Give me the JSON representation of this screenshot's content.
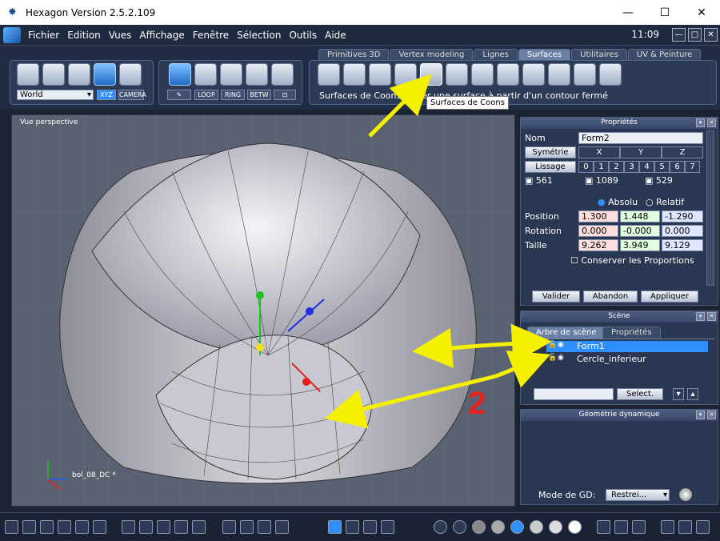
{
  "window": {
    "title": "Hexagon Version 2.5.2.109",
    "minimize": "—",
    "maximize": "☐",
    "close": "✕"
  },
  "menu": {
    "items": [
      "Fichier",
      "Edition",
      "Vues",
      "Affichage",
      "Fenêtre",
      "Sélection",
      "Outils",
      "Aide"
    ],
    "clock": "11:09"
  },
  "tabs": [
    "Primitives 3D",
    "Vertex modeling",
    "Lignes",
    "Surfaces",
    "Utilitaires",
    "UV & Peinture"
  ],
  "active_tab": "Surfaces",
  "toolbar": {
    "coord_system": "World",
    "xyz": "XYZ",
    "camera": "CAMERA",
    "loop": "LOOP",
    "ring": "RING",
    "betw": "BETW",
    "hint": "Surfaces de Coons: Créer une surface à partir d'un contour fermé",
    "tooltip": "Surfaces de Coons"
  },
  "viewport": {
    "label": "Vue perspective",
    "object": "bol_08_DC *"
  },
  "properties": {
    "title": "Propriétés",
    "name_label": "Nom",
    "name_value": "Form2",
    "symmetry": "Symétrie",
    "axes": [
      "X",
      "Y",
      "Z"
    ],
    "smoothing": "Lissage",
    "smooth_levels": [
      "0",
      "1",
      "2",
      "3",
      "4",
      "5",
      "6",
      "7"
    ],
    "counts": [
      "561",
      "1089",
      "529"
    ],
    "absolute": "Absolu",
    "relative": "Relatif",
    "position_label": "Position",
    "position": [
      "1.300",
      "1.448",
      "-1.290"
    ],
    "rotation_label": "Rotation",
    "rotation": [
      "0.000",
      "-0.000",
      "0.000"
    ],
    "size_label": "Taille",
    "size": [
      "9.262",
      "3.949",
      "9.129"
    ],
    "keep_proportions": "Conserver les Proportions",
    "validate": "Valider",
    "cancel": "Abandon",
    "apply": "Appliquer"
  },
  "scene": {
    "title": "Scène",
    "tab_tree": "Arbre de scène",
    "tab_props": "Propriétés",
    "items": [
      "Form1",
      "Cercle_inferieur"
    ],
    "select_btn": "Select."
  },
  "dyn_geo": {
    "title": "Géométrie dynamique",
    "mode_label": "Mode de GD:",
    "mode_value": "Restrei..."
  },
  "annotation": {
    "number": "2"
  },
  "colors": {
    "accent": "#2f8fff",
    "arrow": "#f5f000",
    "marker": "#e82020"
  }
}
